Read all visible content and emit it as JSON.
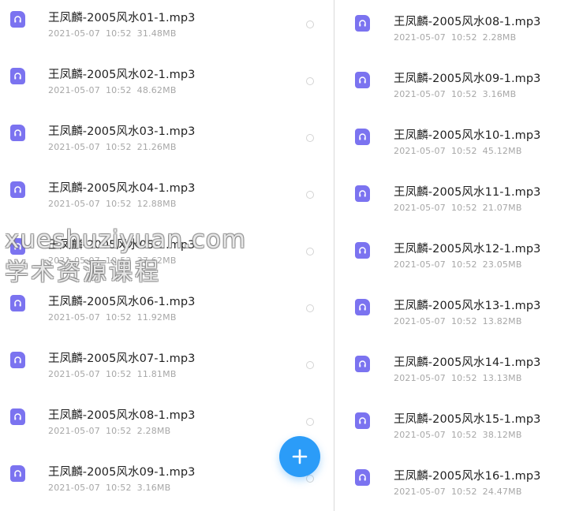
{
  "left_panel": {
    "files": [
      {
        "name": "王凤麟-2005风水01-1.mp3",
        "date": "2021-05-07",
        "time": "10:52",
        "size": "31.48MB"
      },
      {
        "name": "王凤麟-2005风水02-1.mp3",
        "date": "2021-05-07",
        "time": "10:52",
        "size": "48.62MB"
      },
      {
        "name": "王凤麟-2005风水03-1.mp3",
        "date": "2021-05-07",
        "time": "10:52",
        "size": "21.26MB"
      },
      {
        "name": "王凤麟-2005风水04-1.mp3",
        "date": "2021-05-07",
        "time": "10:52",
        "size": "12.88MB"
      },
      {
        "name": "王凤麟-2005风水05-1.mp3",
        "date": "2021-05-07",
        "time": "10:52",
        "size": "37.62MB"
      },
      {
        "name": "王凤麟-2005风水06-1.mp3",
        "date": "2021-05-07",
        "time": "10:52",
        "size": "11.92MB"
      },
      {
        "name": "王凤麟-2005风水07-1.mp3",
        "date": "2021-05-07",
        "time": "10:52",
        "size": "11.81MB"
      },
      {
        "name": "王凤麟-2005风水08-1.mp3",
        "date": "2021-05-07",
        "time": "10:52",
        "size": "2.28MB"
      },
      {
        "name": "王凤麟-2005风水09-1.mp3",
        "date": "2021-05-07",
        "time": "10:52",
        "size": "3.16MB"
      }
    ]
  },
  "right_panel": {
    "files": [
      {
        "name": "王凤麟-2005风水08-1.mp3",
        "date": "2021-05-07",
        "time": "10:52",
        "size": "2.28MB"
      },
      {
        "name": "王凤麟-2005风水09-1.mp3",
        "date": "2021-05-07",
        "time": "10:52",
        "size": "3.16MB"
      },
      {
        "name": "王凤麟-2005风水10-1.mp3",
        "date": "2021-05-07",
        "time": "10:52",
        "size": "45.12MB"
      },
      {
        "name": "王凤麟-2005风水11-1.mp3",
        "date": "2021-05-07",
        "time": "10:52",
        "size": "21.07MB"
      },
      {
        "name": "王凤麟-2005风水12-1.mp3",
        "date": "2021-05-07",
        "time": "10:52",
        "size": "23.05MB"
      },
      {
        "name": "王凤麟-2005风水13-1.mp3",
        "date": "2021-05-07",
        "time": "10:52",
        "size": "13.82MB"
      },
      {
        "name": "王凤麟-2005风水14-1.mp3",
        "date": "2021-05-07",
        "time": "10:52",
        "size": "13.13MB"
      },
      {
        "name": "王凤麟-2005风水15-1.mp3",
        "date": "2021-05-07",
        "time": "10:52",
        "size": "38.12MB"
      },
      {
        "name": "王凤麟-2005风水16-1.mp3",
        "date": "2021-05-07",
        "time": "10:52",
        "size": "24.47MB"
      }
    ]
  },
  "fab": {
    "icon": "plus-icon",
    "color": "#2b9cf8"
  },
  "file_icon": {
    "icon": "audio-file-icon",
    "color": "#7b73f0"
  },
  "watermark": {
    "line1": "xueshuziyuan.com",
    "line2": "学术资源课程"
  }
}
